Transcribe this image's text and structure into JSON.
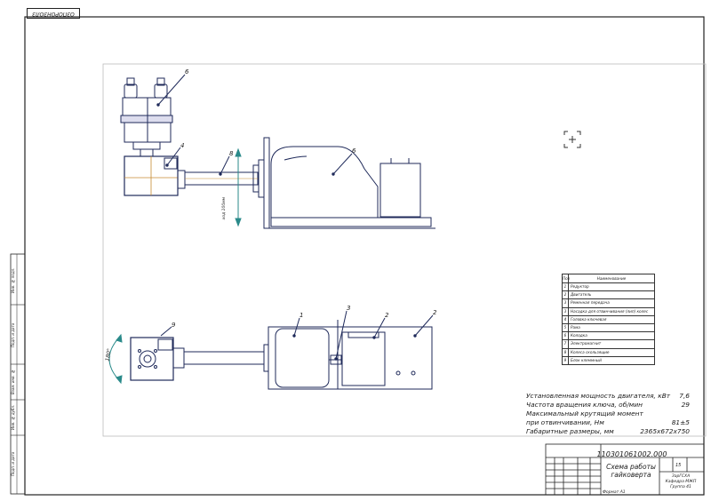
{
  "sheet": {
    "top_stamp": "ОЗПОРОНЗОЛЗ"
  },
  "callouts": {
    "top_view": [
      "6",
      "4",
      "8",
      "6"
    ],
    "plan_view": [
      "1",
      "3",
      "2",
      "2",
      "9"
    ]
  },
  "dimensions": {
    "lift_label": "ход 100мм",
    "rotation_label": "180°"
  },
  "spec_table": {
    "header": {
      "num": "Поз",
      "name": "Наименование"
    },
    "rows": [
      {
        "num": "1",
        "name": "Редуктор"
      },
      {
        "num": "2",
        "name": "Двигатель"
      },
      {
        "num": "3",
        "name": "Ременная передача"
      },
      {
        "num": "3",
        "name": "Насадка для отвинчивания (лип) колес"
      },
      {
        "num": "4",
        "name": "Головка ключевая"
      },
      {
        "num": "5",
        "name": "Рама"
      },
      {
        "num": "6",
        "name": "Колодка"
      },
      {
        "num": "7",
        "name": "Электромагнит"
      },
      {
        "num": "8",
        "name": "Колеса скользящие"
      },
      {
        "num": "9",
        "name": "Блок клеммный"
      }
    ]
  },
  "tech_notes": [
    {
      "label": "Установленная мощность двигателя, кВт",
      "value": "7,6"
    },
    {
      "label": "Частота вращения ключа, об/мин",
      "value": "29"
    },
    {
      "label": "Максимальный крутящий момент",
      "value": ""
    },
    {
      "label": "при отвинчивании, Нм",
      "value": "81±5"
    },
    {
      "label": "Габаритные размеры, мм",
      "value": "2365х672х750"
    }
  ],
  "title_block": {
    "doc_code": "110301061002.000",
    "title_line1": "Схема работы",
    "title_line2": "гайковерта",
    "format": "Формат А1",
    "sheet_no": "15",
    "org_line1": "ЗарГСХА",
    "org_line2": "Кафедра МЖП",
    "org_line3": "Группа 41"
  },
  "left_strip_labels": [
    "Инв. № подл.",
    "Подп. и дата",
    "Взам. инв. №",
    "Инв. № дубл.",
    "Подп. и дата"
  ]
}
